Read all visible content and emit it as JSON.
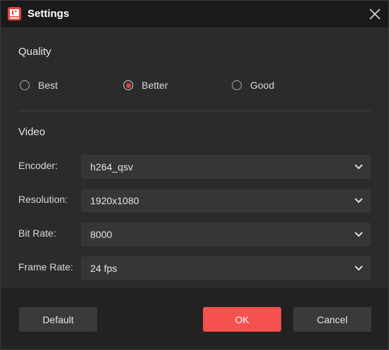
{
  "window": {
    "title": "Settings",
    "logo_icon": "app-logo-icon",
    "close_icon": "close-icon",
    "accent_color": "#f5514e"
  },
  "quality": {
    "heading": "Quality",
    "options": [
      {
        "label": "Best",
        "selected": false
      },
      {
        "label": "Better",
        "selected": true
      },
      {
        "label": "Good",
        "selected": false
      }
    ]
  },
  "video": {
    "heading": "Video",
    "fields": [
      {
        "label": "Encoder:",
        "value": "h264_qsv"
      },
      {
        "label": "Resolution:",
        "value": "1920x1080"
      },
      {
        "label": "Bit Rate:",
        "value": "8000"
      },
      {
        "label": "Frame Rate:",
        "value": "24 fps"
      }
    ]
  },
  "footer": {
    "default_label": "Default",
    "ok_label": "OK",
    "cancel_label": "Cancel"
  }
}
